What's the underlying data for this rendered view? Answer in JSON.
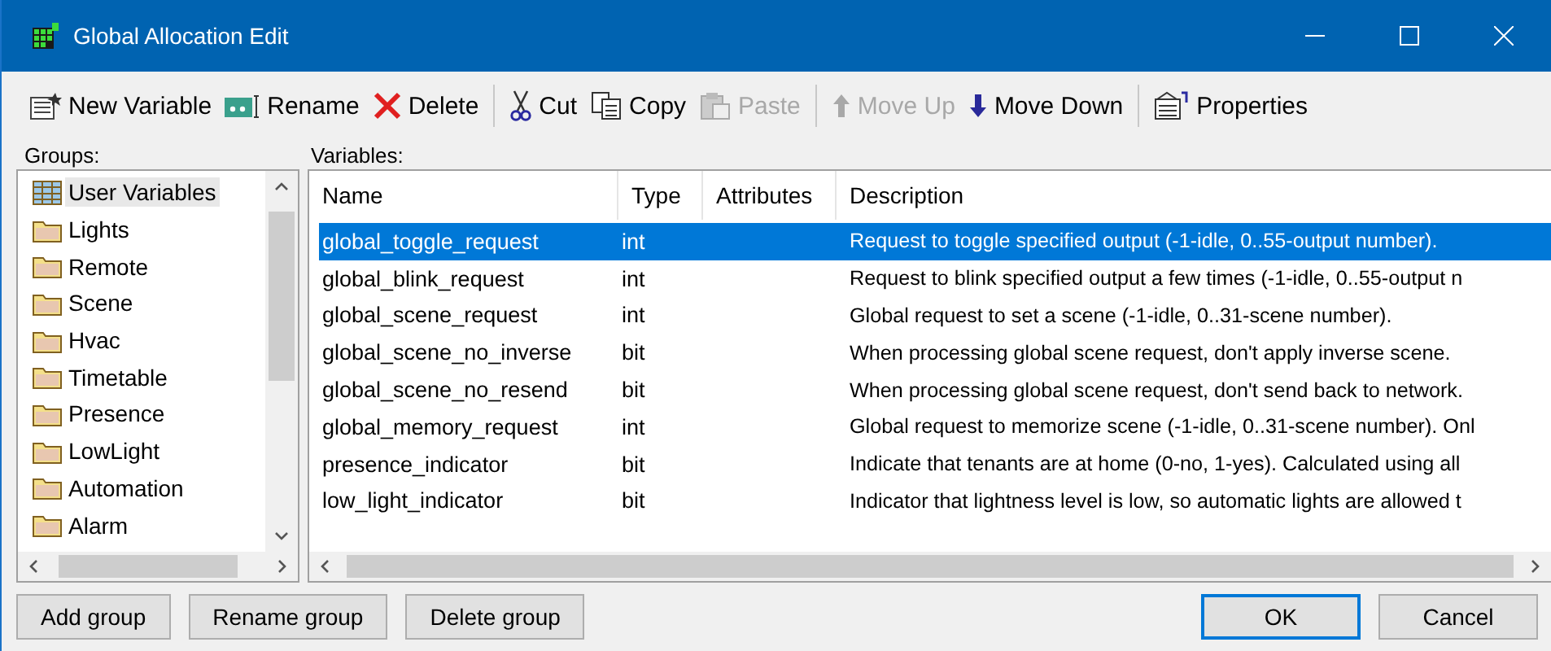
{
  "window": {
    "title": "Global Allocation Edit"
  },
  "toolbar": {
    "groups": [
      [
        {
          "label": "New Variable",
          "kind": "new",
          "disabled": false
        },
        {
          "label": "Rename",
          "kind": "rename",
          "disabled": false
        },
        {
          "label": "Delete",
          "kind": "delete",
          "disabled": false
        }
      ],
      [
        {
          "label": "Cut",
          "kind": "cut",
          "disabled": false
        },
        {
          "label": "Copy",
          "kind": "copy",
          "disabled": false
        },
        {
          "label": "Paste",
          "kind": "paste",
          "disabled": true
        }
      ],
      [
        {
          "label": "Move Up",
          "kind": "up",
          "disabled": true
        },
        {
          "label": "Move Down",
          "kind": "down",
          "disabled": false
        }
      ],
      [
        {
          "label": "Properties",
          "kind": "properties",
          "disabled": false
        }
      ]
    ]
  },
  "groups": {
    "label": "Groups:",
    "items": [
      {
        "label": "User Variables",
        "kind": "root",
        "selected": true
      },
      {
        "label": "Lights",
        "kind": "folder",
        "selected": false
      },
      {
        "label": "Remote",
        "kind": "folder",
        "selected": false
      },
      {
        "label": "Scene",
        "kind": "folder",
        "selected": false
      },
      {
        "label": "Hvac",
        "kind": "folder",
        "selected": false
      },
      {
        "label": "Timetable",
        "kind": "folder",
        "selected": false
      },
      {
        "label": "Presence",
        "kind": "folder",
        "selected": false
      },
      {
        "label": "LowLight",
        "kind": "folder",
        "selected": false
      },
      {
        "label": "Automation",
        "kind": "folder",
        "selected": false
      },
      {
        "label": "Alarm",
        "kind": "folder",
        "selected": false
      }
    ]
  },
  "variables": {
    "label": "Variables:",
    "columns": [
      "Name",
      "Type",
      "Attributes",
      "Description"
    ],
    "rows": [
      {
        "name": "global_toggle_request",
        "type": "int",
        "description": "Request to toggle specified output (-1-idle, 0..55-output number).",
        "selected": true
      },
      {
        "name": "global_blink_request",
        "type": "int",
        "description": "Request to blink specified output a few times (-1-idle, 0..55-output n",
        "selected": false
      },
      {
        "name": "global_scene_request",
        "type": "int",
        "description": "Global request to set a scene (-1-idle, 0..31-scene number).",
        "selected": false
      },
      {
        "name": "global_scene_no_inverse",
        "type": "bit",
        "description": "When processing global scene request, don't apply inverse scene.",
        "selected": false
      },
      {
        "name": "global_scene_no_resend",
        "type": "bit",
        "description": "When processing global scene request, don't send back to network.",
        "selected": false
      },
      {
        "name": "global_memory_request",
        "type": "int",
        "description": "Global request to memorize scene (-1-idle, 0..31-scene number). Onl",
        "selected": false
      },
      {
        "name": "presence_indicator",
        "type": "bit",
        "description": "Indicate that tenants are at home (0-no, 1-yes). Calculated using all",
        "selected": false
      },
      {
        "name": "low_light_indicator",
        "type": "bit",
        "description": "Indicator that lightness level is low, so automatic lights are allowed t",
        "selected": false
      }
    ]
  },
  "group_buttons": [
    "Add group",
    "Rename group",
    "Delete group"
  ],
  "dialog_buttons": [
    {
      "label": "OK",
      "default": true
    },
    {
      "label": "Cancel",
      "default": false
    }
  ]
}
